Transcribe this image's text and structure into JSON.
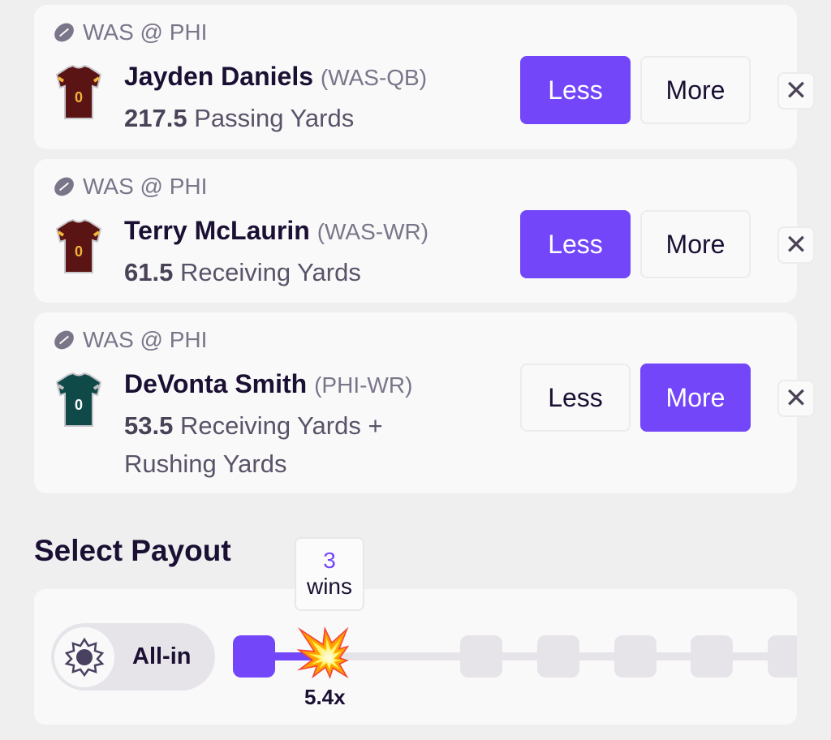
{
  "picks": [
    {
      "matchup": "WAS @ PHI",
      "player": "Jayden Daniels",
      "position": "(WAS-QB)",
      "line": "217.5",
      "stat": "Passing Yards",
      "less": "Less",
      "more": "More",
      "selected": "less",
      "jersey_color": "#5a1414",
      "jersey_number": "0"
    },
    {
      "matchup": "WAS @ PHI",
      "player": "Terry McLaurin",
      "position": "(WAS-WR)",
      "line": "61.5",
      "stat": "Receiving Yards",
      "less": "Less",
      "more": "More",
      "selected": "less",
      "jersey_color": "#5a1414",
      "jersey_number": "0"
    },
    {
      "matchup": "WAS @ PHI",
      "player": "DeVonta Smith",
      "position": "(PHI-WR)",
      "line": "53.5",
      "stat": "Receiving Yards + Rushing Yards",
      "less": "Less",
      "more": "More",
      "selected": "more",
      "jersey_color": "#0f4a48",
      "jersey_number": "0"
    }
  ],
  "remove_label": "✕",
  "payout": {
    "title": "Select Payout",
    "tooltip_count": "3",
    "tooltip_label": "wins",
    "all_in_label": "All-in",
    "multiplier": "5.4x",
    "selected_step": 2,
    "total_steps": 8,
    "accent": "#7346f9",
    "emoji": "💥"
  }
}
